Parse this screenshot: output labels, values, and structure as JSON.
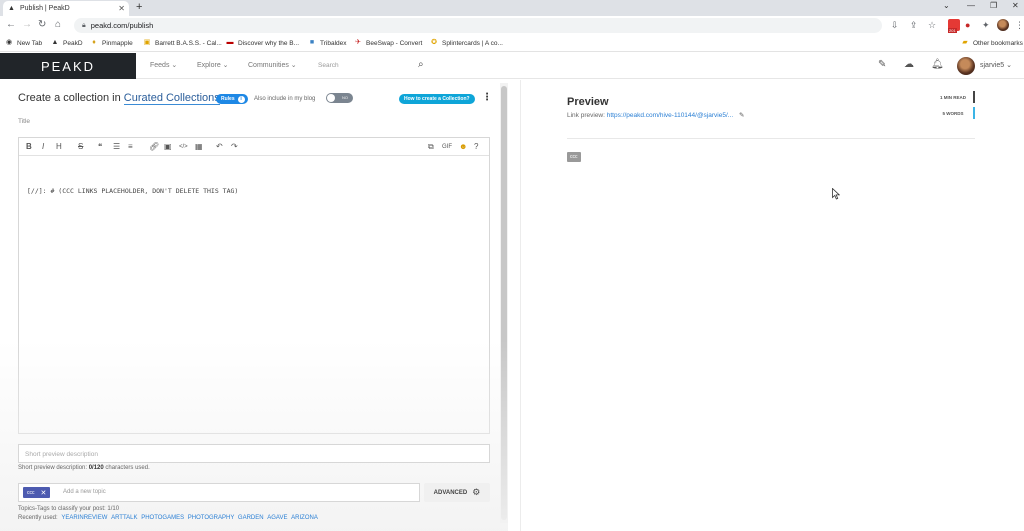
{
  "browser": {
    "tab_title": "Publish | PeakD",
    "url": "peakd.com/publish",
    "ext_badge": "201",
    "bookmarks": [
      {
        "label": "New Tab",
        "icon": "globe-icon"
      },
      {
        "label": "PeakD",
        "icon": "peakd-icon"
      },
      {
        "label": "Pinmapple",
        "icon": "pin-icon"
      },
      {
        "label": "Barrett B.A.S.S. - Cal...",
        "icon": "calendar-icon"
      },
      {
        "label": "Discover why the B...",
        "icon": "bww-icon"
      },
      {
        "label": "Tribaldex",
        "icon": "tribaldex-icon"
      },
      {
        "label": "BeeSwap - Convert",
        "icon": "bee-icon"
      },
      {
        "label": "Splintercards | A co...",
        "icon": "splinter-icon"
      }
    ],
    "other_bookmarks": "Other bookmarks"
  },
  "header": {
    "logo": "PEAKD",
    "nav": [
      "Feeds",
      "Explore",
      "Communities"
    ],
    "search_placeholder": "Search",
    "username": "sjarvie5"
  },
  "editor": {
    "title_prefix": "Create a collection in",
    "collection": "Curated Collections",
    "rules_label": "Rules",
    "also_include": "Also include in my blog",
    "toggle_label": "NO",
    "howto_label": "How to create a Collection?",
    "title_placeholder": "Title",
    "body": "[//]: # (CCC LINKS PLACEHOLDER, DON'T DELETE THIS TAG)",
    "description_placeholder": "Short preview description",
    "description_count_label": "Short preview description:",
    "description_count": "0/120",
    "description_count_suffix": "characters used.",
    "tag_chip": "ccc",
    "tag_placeholder": "Add a new topic",
    "advanced_label": "ADVANCED",
    "tags_help": "Topics-Tags to classify your post: 1/10",
    "recent_label": "Recently used:",
    "recent_tags": [
      "YEARINREVIEW",
      "ARTTALK",
      "PHOTOGAMES",
      "PHOTOGRAPHY",
      "GARDEN",
      "AGAVE",
      "ARIZONA"
    ]
  },
  "preview": {
    "title": "Preview",
    "link_label": "Link preview:",
    "link_url": "https://peakd.com/hive-110144/@sjarvie5/...",
    "read_time": "1 MIN READ",
    "words": "5 WORDS",
    "tag": "ccc"
  }
}
